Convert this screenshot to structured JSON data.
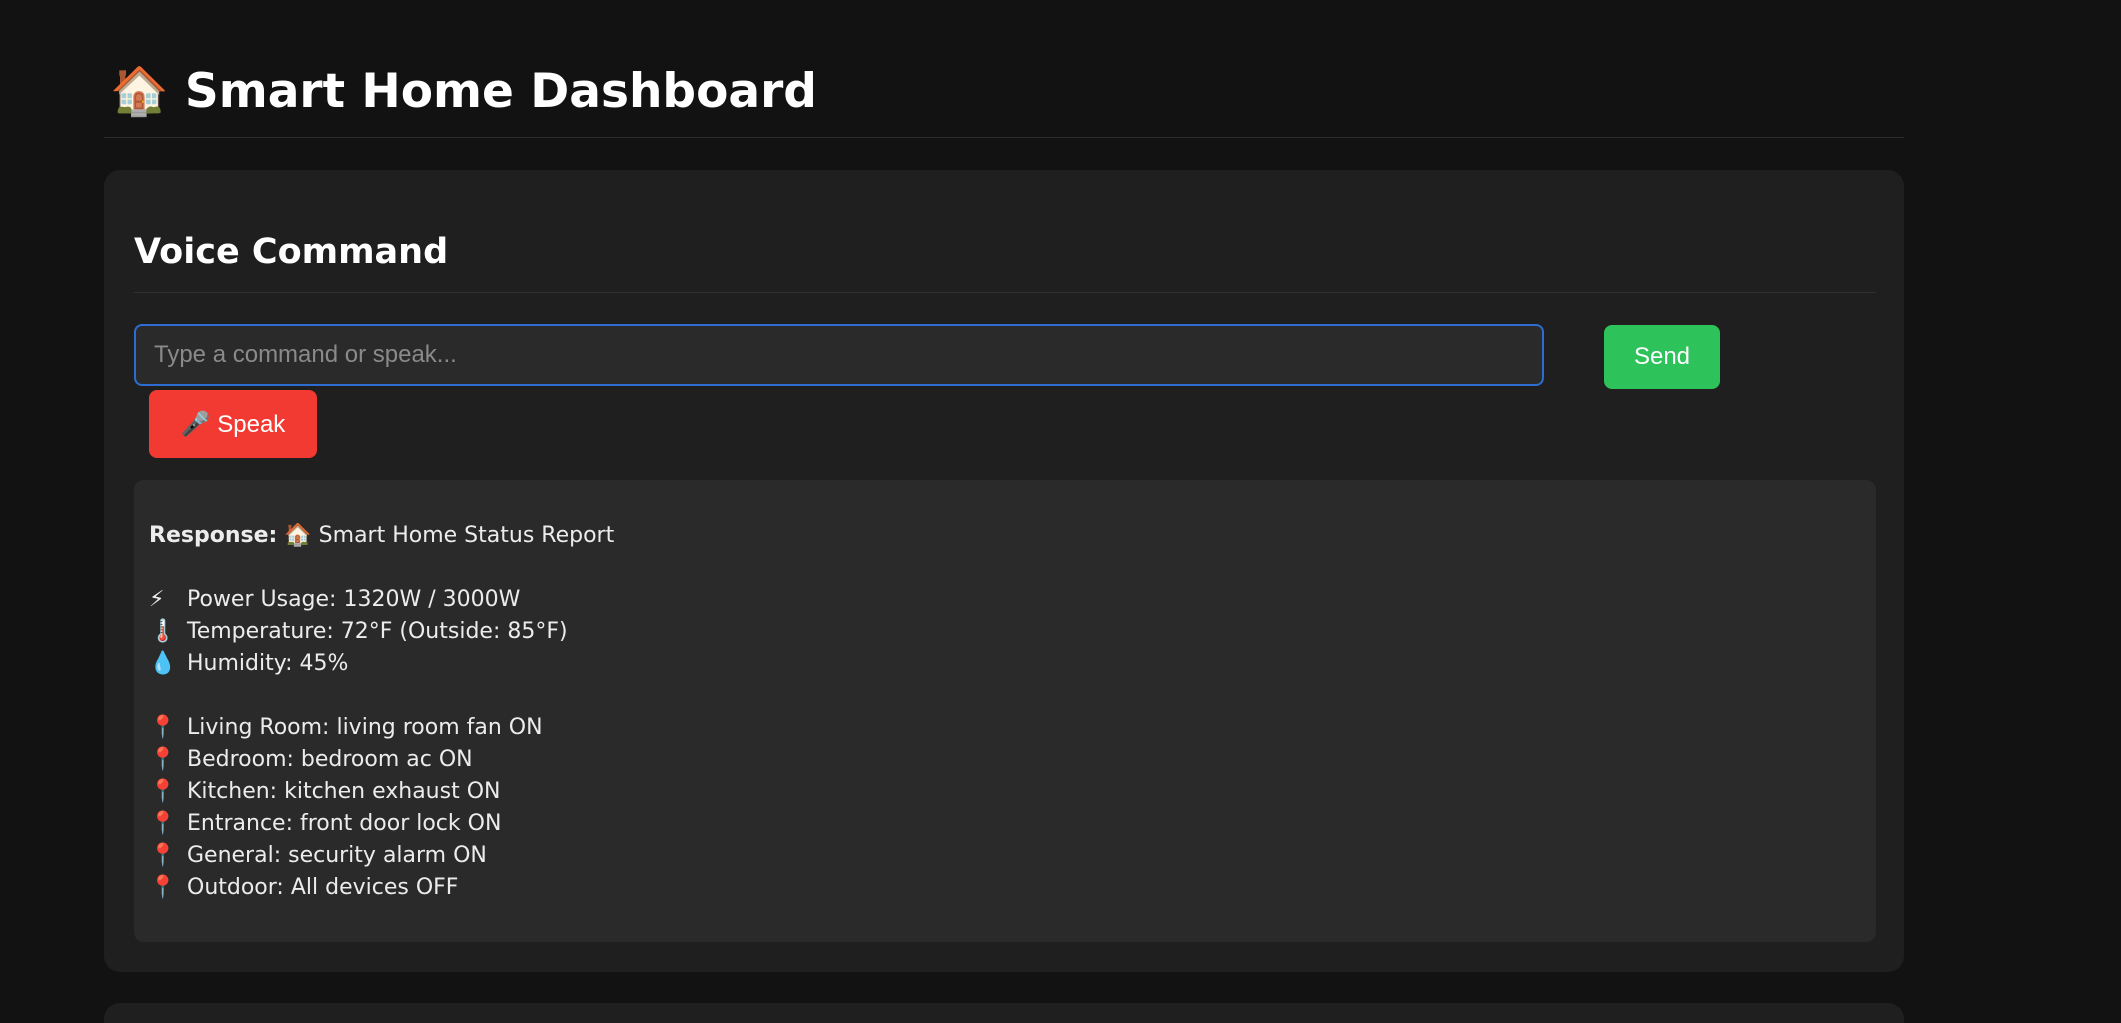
{
  "header": {
    "title": "🏠 Smart Home Dashboard"
  },
  "voice_command": {
    "title": "Voice Command",
    "input_value": "",
    "input_placeholder": "Type a command or speak...",
    "send_label": "Send",
    "speak_label": "🎤 Speak"
  },
  "response": {
    "label": "Response:",
    "heading": "🏠 Smart Home Status Report",
    "stats": [
      {
        "icon": "⚡",
        "icon_name": "lightning-icon",
        "text": "Power Usage: 1320W / 3000W"
      },
      {
        "icon": "🌡️",
        "icon_name": "thermometer-icon",
        "text": "Temperature: 72°F (Outside: 85°F)"
      },
      {
        "icon": "💧",
        "icon_name": "droplet-icon",
        "text": "Humidity: 45%"
      }
    ],
    "rooms": [
      {
        "icon": "📍",
        "icon_name": "pin-icon",
        "text": "Living Room: living room fan ON"
      },
      {
        "icon": "📍",
        "icon_name": "pin-icon",
        "text": "Bedroom: bedroom ac ON"
      },
      {
        "icon": "📍",
        "icon_name": "pin-icon",
        "text": "Kitchen: kitchen exhaust ON"
      },
      {
        "icon": "📍",
        "icon_name": "pin-icon",
        "text": "Entrance: front door lock ON"
      },
      {
        "icon": "📍",
        "icon_name": "pin-icon",
        "text": "General: security alarm ON"
      },
      {
        "icon": "📍",
        "icon_name": "pin-icon",
        "text": "Outdoor: All devices OFF"
      }
    ]
  },
  "colors": {
    "background": "#121212",
    "card": "#1f1f1f",
    "send_button": "#2ec25a",
    "speak_button": "#f23a33",
    "input_border": "#2d6cd0"
  }
}
